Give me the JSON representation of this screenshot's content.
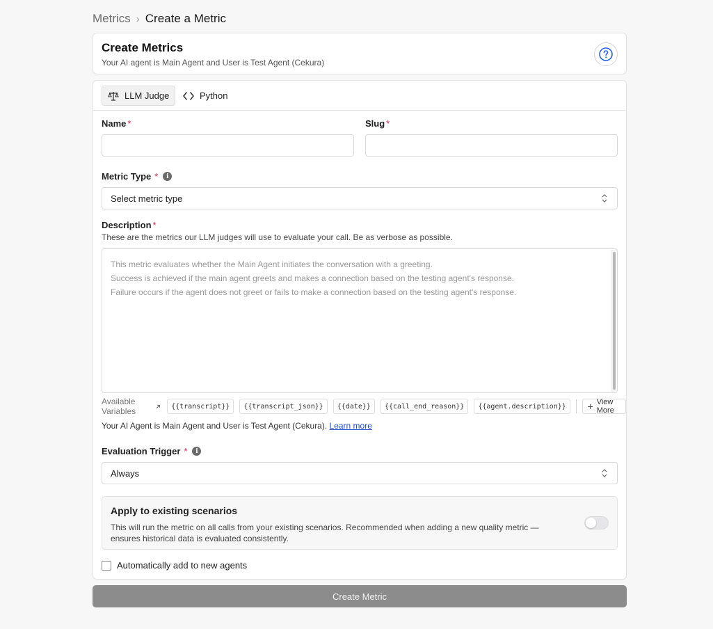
{
  "breadcrumb": {
    "parent": "Metrics",
    "separator": "›",
    "current": "Create a Metric"
  },
  "header": {
    "title": "Create Metrics",
    "subtitle": "Your AI agent is Main Agent and User is Test Agent (Cekura)",
    "help_icon": "question-circle-icon"
  },
  "tabs": [
    {
      "label": "LLM Judge",
      "icon": "scale-icon",
      "active": true
    },
    {
      "label": "Python",
      "icon": "code-icon",
      "active": false
    }
  ],
  "form": {
    "name_label": "Name",
    "name_value": "",
    "slug_label": "Slug",
    "slug_value": "",
    "required_mark": "*",
    "metric_type_label": "Metric Type",
    "metric_type_value": "Select metric type",
    "info_glyph": "i",
    "description_label": "Description",
    "description_help": "These are the metrics our LLM judges will use to evaluate your call. Be as verbose as possible.",
    "description_placeholder": "This metric evaluates whether the Main Agent initiates the conversation with a greeting.\nSuccess is achieved if the main agent greets and makes a connection based on the testing agent's response.\nFailure occurs if the agent does not greet or fails to make a connection based on the testing agent's response.",
    "variables_label": "Available Variables",
    "variables": [
      "{{transcript}}",
      "{{transcript_json}}",
      "{{date}}",
      "{{call_end_reason}}",
      "{{agent.description}}"
    ],
    "view_more": "View More",
    "agent_info": "Your AI Agent is Main Agent and User is Test Agent (Cekura).",
    "learn_more": "Learn more",
    "trigger_label": "Evaluation Trigger",
    "trigger_value": "Always",
    "apply_title": "Apply to existing scenarios",
    "apply_desc": "This will run the metric on all calls from your existing scenarios. Recommended when adding a new quality metric — ensures historical data is evaluated consistently.",
    "apply_enabled": false,
    "auto_add_label": "Automatically add to new agents",
    "auto_add_checked": false
  },
  "submit_label": "Create Metric",
  "colors": {
    "required": "#e11d48",
    "link": "#1d4ed8",
    "submit_bg": "#8c8c8c",
    "help_icon": "#2563eb"
  }
}
